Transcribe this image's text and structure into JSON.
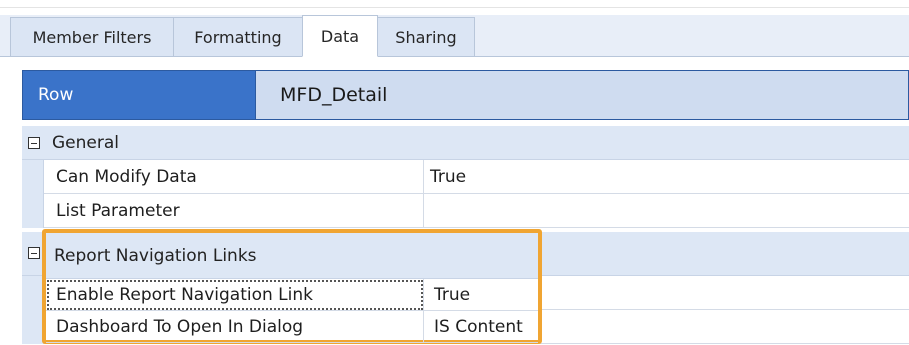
{
  "tabs": [
    {
      "label": "Member Filters",
      "active": false
    },
    {
      "label": "Formatting",
      "active": false
    },
    {
      "label": "Data",
      "active": true
    },
    {
      "label": "Sharing",
      "active": false
    }
  ],
  "grid": {
    "row_header": {
      "label": "Row",
      "value": "MFD_Detail"
    },
    "categories": [
      {
        "label": "General",
        "expanded": true,
        "toggle_icon": "collapse-box-icon",
        "properties": [
          {
            "name": "Can Modify Data",
            "value": "True"
          },
          {
            "name": "List Parameter",
            "value": ""
          }
        ]
      },
      {
        "label": "Report Navigation Links",
        "expanded": true,
        "toggle_icon": "collapse-box-icon",
        "properties": [
          {
            "name": "Enable Report Navigation Link",
            "value": "True",
            "selected": true
          },
          {
            "name": "Dashboard To Open In Dialog",
            "value": "IS Content"
          }
        ]
      }
    ]
  },
  "colors": {
    "header_blue": "#3a73c9",
    "category_bg": "#dde7f5",
    "highlight_orange": "#f0a532"
  }
}
